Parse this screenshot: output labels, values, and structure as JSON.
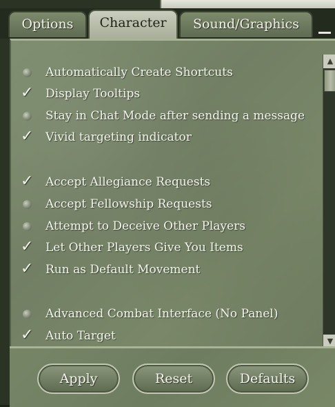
{
  "tabs": [
    {
      "label": "Options",
      "active": false
    },
    {
      "label": "Character",
      "active": true
    },
    {
      "label": "Sound/Graphics",
      "active": false
    }
  ],
  "options": [
    {
      "label": "Automatically Create Shortcuts",
      "checked": false
    },
    {
      "label": "Display Tooltips",
      "checked": true
    },
    {
      "label": "Stay in Chat Mode after sending a message",
      "checked": false
    },
    {
      "label": "Vivid targeting indicator",
      "checked": true
    },
    {
      "label": "Accept Allegiance Requests",
      "checked": true
    },
    {
      "label": "Accept Fellowship Requests",
      "checked": false
    },
    {
      "label": "Attempt to Deceive Other Players",
      "checked": false
    },
    {
      "label": "Let Other Players Give You Items",
      "checked": true
    },
    {
      "label": "Run as Default Movement",
      "checked": true
    },
    {
      "label": "Advanced Combat Interface (No Panel)",
      "checked": false
    },
    {
      "label": "Auto Target",
      "checked": true
    }
  ],
  "buttons": {
    "apply": "Apply",
    "reset": "Reset",
    "defaults": "Defaults"
  },
  "icons": {
    "checked": "checkmark-icon",
    "unchecked": "bullet-dot-icon",
    "scroll_up": "arrow-up-icon",
    "scroll_down": "arrow-down-icon",
    "minimize": "minimize-icon"
  },
  "colors": {
    "panel": "#7a8869",
    "tab_active": "#b9bea9",
    "text": "#f4f4ee"
  }
}
